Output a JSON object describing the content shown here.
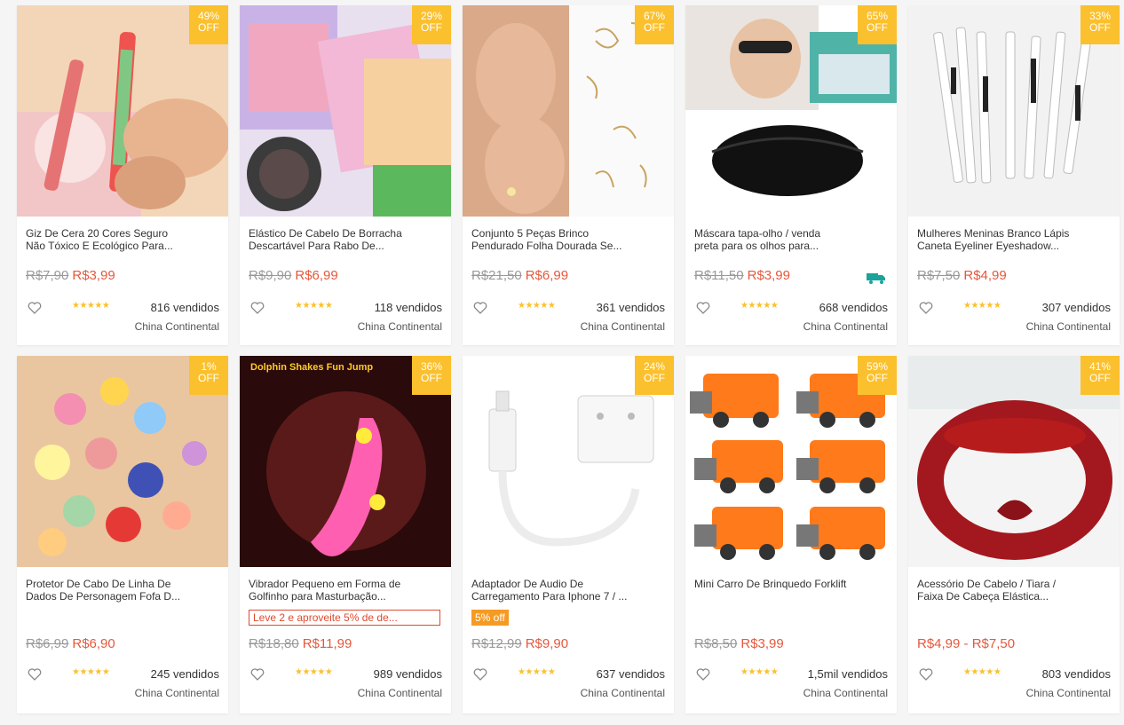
{
  "products": [
    {
      "discount": "49%",
      "off": "OFF",
      "title1": "Giz De Cera 20 Cores Seguro",
      "title2": "Não Tóxico E Ecológico Para...",
      "old": "R$7,90",
      "price": "R$3,99",
      "sold": "816 vendidos",
      "origin": "China Continental",
      "stars": "★★★★★"
    },
    {
      "discount": "29%",
      "off": "OFF",
      "title1": "Elástico De Cabelo De Borracha",
      "title2": "Descartável Para Rabo De...",
      "old": "R$9,90",
      "price": "R$6,99",
      "sold": "118 vendidos",
      "origin": "China Continental",
      "stars": "★★★★★"
    },
    {
      "discount": "67%",
      "off": "OFF",
      "title1": "Conjunto 5 Peças Brinco",
      "title2": "Pendurado Folha Dourada Se...",
      "old": "R$21,50",
      "price": "R$6,99",
      "sold": "361 vendidos",
      "origin": "China Continental",
      "stars": "★★★★★"
    },
    {
      "discount": "65%",
      "off": "OFF",
      "title1": "Máscara tapa-olho / venda",
      "title2": "preta para os olhos para...",
      "old": "R$11,50",
      "price": "R$3,99",
      "sold": "668 vendidos",
      "origin": "China Continental",
      "stars": "★★★★★",
      "free_shipping_icon": "truck-icon"
    },
    {
      "discount": "33%",
      "off": "OFF",
      "title1": "Mulheres Meninas Branco Lápis",
      "title2": "Caneta Eyeliner Eyeshadow...",
      "old": "R$7,50",
      "price": "R$4,99",
      "sold": "307 vendidos",
      "origin": "China Continental",
      "stars": "★★★★★"
    },
    {
      "discount": "1%",
      "off": "OFF",
      "title1": "Protetor De Cabo De Linha De",
      "title2": "Dados De Personagem Fofa D...",
      "old": "R$6,99",
      "price": "R$6,90",
      "sold": "245 vendidos",
      "origin": "China Continental",
      "stars": "★★★★★"
    },
    {
      "discount": "36%",
      "off": "OFF",
      "title1": "Vibrador Pequeno em Forma de",
      "title2": "Golfinho para Masturbação...",
      "promo": "Leve 2 e aproveite 5% de de...",
      "old": "R$18,80",
      "price": "R$11,99",
      "sold": "989 vendidos",
      "origin": "China Continental",
      "stars": "★★★★★",
      "image_text": "Dolphin Shakes Fun Jump"
    },
    {
      "discount": "24%",
      "off": "OFF",
      "title1": "Adaptador De Audio De",
      "title2": "Carregamento Para Iphone 7 / ...",
      "tag": "5% off",
      "old": "R$12,99",
      "price": "R$9,90",
      "sold": "637 vendidos",
      "origin": "China Continental",
      "stars": "★★★★★"
    },
    {
      "discount": "59%",
      "off": "OFF",
      "title1": "Mini Carro De Brinquedo Forklift",
      "title2": "",
      "old": "R$8,50",
      "price": "R$3,99",
      "sold": "1,5mil vendidos",
      "origin": "China Continental",
      "stars": "★★★★★"
    },
    {
      "discount": "41%",
      "off": "OFF",
      "title1": "Acessório De Cabelo / Tiara /",
      "title2": "Faixa De Cabeça Elástica...",
      "range": "R$4,99 - R$7,50",
      "sold": "803 vendidos",
      "origin": "China Continental",
      "stars": "★★★★★"
    }
  ],
  "icons": {
    "heart": "heart-outline-icon",
    "truck": "truck-icon"
  },
  "colors": {
    "badge": "#fbc02d",
    "price": "#e5583c",
    "promo": "#e04a2f",
    "tag": "#f59b24",
    "truck": "#1aa39a"
  }
}
